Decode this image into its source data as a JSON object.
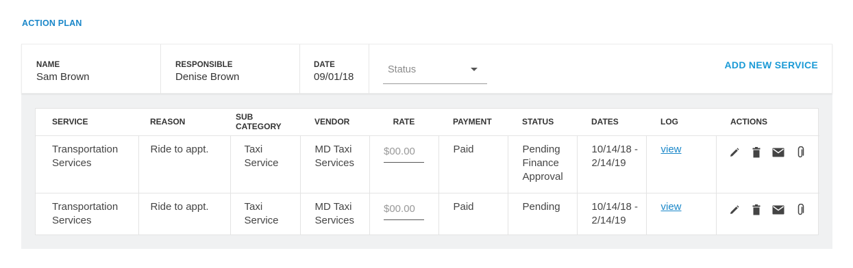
{
  "section": {
    "title": "ACTION PLAN"
  },
  "header": {
    "name_label": "NAME",
    "name_value": "Sam Brown",
    "responsible_label": "RESPONSIBLE",
    "responsible_value": "Denise Brown",
    "date_label": "DATE",
    "date_value": "09/01/18",
    "status_placeholder": "Status",
    "add_new_label": "ADD NEW SERVICE"
  },
  "table": {
    "columns": [
      "SERVICE",
      "REASON",
      "SUB CATEGORY",
      "VENDOR",
      "RATE",
      "PAYMENT",
      "STATUS",
      "DATES",
      "LOG",
      "ACTIONS"
    ],
    "rows": [
      {
        "service": "Transportation Services",
        "reason": "Ride to appt.",
        "sub_category": "Taxi Service",
        "vendor": "MD Taxi Services",
        "rate_placeholder": "$00.00",
        "payment": "Paid",
        "status": "Pending Finance Approval",
        "dates": "10/14/18 - 2/14/19",
        "log": "view"
      },
      {
        "service": "Transportation Services",
        "reason": "Ride to appt.",
        "sub_category": "Taxi Service",
        "vendor": "MD Taxi Services",
        "rate_placeholder": "$00.00",
        "payment": "Paid",
        "status": "Pending",
        "dates": "10/14/18 - 2/14/19",
        "log": "view"
      }
    ],
    "action_icons": [
      "pencil-icon",
      "trash-icon",
      "envelope-icon",
      "paperclip-icon"
    ]
  },
  "colors": {
    "accent": "#1a87c9",
    "link": "#1a9ad6",
    "panel_bg": "#f0f1f2"
  }
}
